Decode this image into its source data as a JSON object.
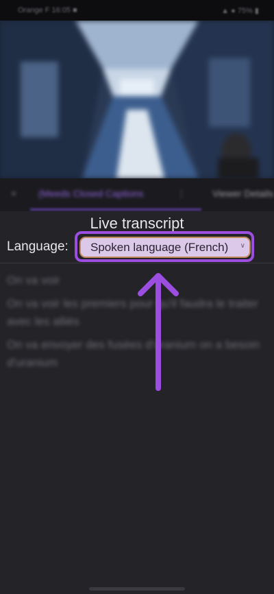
{
  "status_bar": {
    "left_text": "Orange F  16:05 ■",
    "right_text": "▲ ● 75% ▮"
  },
  "tabs": {
    "close_symbol": "×",
    "active_label": "(Meeds Closed Captions",
    "more_symbol": "⋮",
    "other_label": "Viewer Details"
  },
  "transcript_panel": {
    "title": "Live transcript",
    "language_label": "Language:",
    "language_select_value": "Spoken language (French)",
    "chevron_symbol": "∨",
    "lines": [
      "On va voir",
      "On va voir les premiers pour qu'il faudra le traiter avec les alliés",
      "On va envoyer des fusées d'uranium on a besoin d'uranium"
    ]
  },
  "colors": {
    "accent_purple": "#9b4ee0",
    "select_fill": "#dcc9ea",
    "panel_background": "#242328"
  }
}
